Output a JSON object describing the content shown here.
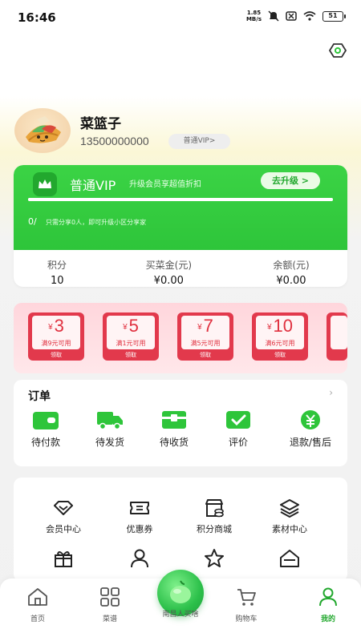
{
  "status_bar": {
    "time": "16:46",
    "net_speed_value": "1.85",
    "net_speed_unit": "MB/s",
    "battery": "51"
  },
  "profile": {
    "name": "菜篮子",
    "phone": "13500000000",
    "vip_tag": "普通VIP>"
  },
  "vip_card": {
    "title": "普通VIP",
    "description": "升级会员享超值折扣",
    "upgrade_button": "去升级 >",
    "progress": 1.0,
    "share_count": "0/",
    "share_hint": "只需分享0人，即可升级小区分享家",
    "stats": [
      {
        "label": "积分",
        "value": "10"
      },
      {
        "label": "买菜金(元)",
        "value": "¥0.00"
      },
      {
        "label": "余额(元)",
        "value": "¥0.00"
      }
    ]
  },
  "coupons": [
    {
      "currency": "¥",
      "amount": "3",
      "condition": "满9元可用",
      "claim": "领取"
    },
    {
      "currency": "¥",
      "amount": "5",
      "condition": "满1元可用",
      "claim": "领取"
    },
    {
      "currency": "¥",
      "amount": "7",
      "condition": "满5元可用",
      "claim": "领取"
    },
    {
      "currency": "¥",
      "amount": "10",
      "condition": "满6元可用",
      "claim": "领取"
    }
  ],
  "orders": {
    "title": "订单",
    "more": "›",
    "items": [
      {
        "label": "待付款",
        "icon": "wallet-icon"
      },
      {
        "label": "待发货",
        "icon": "truck-icon"
      },
      {
        "label": "待收货",
        "icon": "package-icon"
      },
      {
        "label": "评价",
        "icon": "review-icon"
      },
      {
        "label": "退款/售后",
        "icon": "refund-icon"
      }
    ]
  },
  "services": {
    "items": [
      {
        "label": "会员中心",
        "icon": "diamond-icon"
      },
      {
        "label": "优惠券",
        "icon": "ticket-icon"
      },
      {
        "label": "积分商城",
        "icon": "points-mall-icon"
      },
      {
        "label": "素材中心",
        "icon": "layers-icon"
      },
      {
        "label": "",
        "icon": "gift-icon"
      },
      {
        "label": "",
        "icon": "user-icon"
      },
      {
        "label": "",
        "icon": "star-icon"
      },
      {
        "label": "",
        "icon": "home-icon"
      }
    ]
  },
  "tab_bar": {
    "tabs": [
      {
        "label": "首页",
        "icon": "home-icon"
      },
      {
        "label": "菜谱",
        "icon": "grid-icon"
      },
      {
        "label": "南昌人买啥",
        "icon": "bean-icon"
      },
      {
        "label": "购物车",
        "icon": "cart-icon"
      },
      {
        "label": "我的",
        "icon": "profile-icon"
      }
    ],
    "active": "我的"
  },
  "colors": {
    "brand_green": "#2ec53a",
    "coupon_red": "#e2394c"
  }
}
